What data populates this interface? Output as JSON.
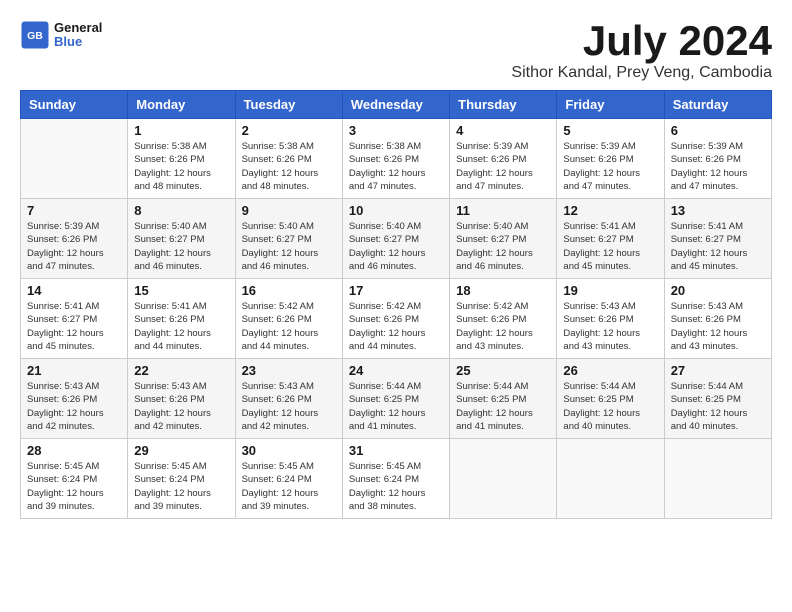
{
  "header": {
    "logo": {
      "general": "General",
      "blue": "Blue"
    },
    "title": "July 2024",
    "location": "Sithor Kandal, Prey Veng, Cambodia"
  },
  "days_of_week": [
    "Sunday",
    "Monday",
    "Tuesday",
    "Wednesday",
    "Thursday",
    "Friday",
    "Saturday"
  ],
  "weeks": [
    [
      {
        "day": "",
        "info": ""
      },
      {
        "day": "1",
        "info": "Sunrise: 5:38 AM\nSunset: 6:26 PM\nDaylight: 12 hours\nand 48 minutes."
      },
      {
        "day": "2",
        "info": "Sunrise: 5:38 AM\nSunset: 6:26 PM\nDaylight: 12 hours\nand 48 minutes."
      },
      {
        "day": "3",
        "info": "Sunrise: 5:38 AM\nSunset: 6:26 PM\nDaylight: 12 hours\nand 47 minutes."
      },
      {
        "day": "4",
        "info": "Sunrise: 5:39 AM\nSunset: 6:26 PM\nDaylight: 12 hours\nand 47 minutes."
      },
      {
        "day": "5",
        "info": "Sunrise: 5:39 AM\nSunset: 6:26 PM\nDaylight: 12 hours\nand 47 minutes."
      },
      {
        "day": "6",
        "info": "Sunrise: 5:39 AM\nSunset: 6:26 PM\nDaylight: 12 hours\nand 47 minutes."
      }
    ],
    [
      {
        "day": "7",
        "info": "Sunrise: 5:39 AM\nSunset: 6:26 PM\nDaylight: 12 hours\nand 47 minutes."
      },
      {
        "day": "8",
        "info": "Sunrise: 5:40 AM\nSunset: 6:27 PM\nDaylight: 12 hours\nand 46 minutes."
      },
      {
        "day": "9",
        "info": "Sunrise: 5:40 AM\nSunset: 6:27 PM\nDaylight: 12 hours\nand 46 minutes."
      },
      {
        "day": "10",
        "info": "Sunrise: 5:40 AM\nSunset: 6:27 PM\nDaylight: 12 hours\nand 46 minutes."
      },
      {
        "day": "11",
        "info": "Sunrise: 5:40 AM\nSunset: 6:27 PM\nDaylight: 12 hours\nand 46 minutes."
      },
      {
        "day": "12",
        "info": "Sunrise: 5:41 AM\nSunset: 6:27 PM\nDaylight: 12 hours\nand 45 minutes."
      },
      {
        "day": "13",
        "info": "Sunrise: 5:41 AM\nSunset: 6:27 PM\nDaylight: 12 hours\nand 45 minutes."
      }
    ],
    [
      {
        "day": "14",
        "info": "Sunrise: 5:41 AM\nSunset: 6:27 PM\nDaylight: 12 hours\nand 45 minutes."
      },
      {
        "day": "15",
        "info": "Sunrise: 5:41 AM\nSunset: 6:26 PM\nDaylight: 12 hours\nand 44 minutes."
      },
      {
        "day": "16",
        "info": "Sunrise: 5:42 AM\nSunset: 6:26 PM\nDaylight: 12 hours\nand 44 minutes."
      },
      {
        "day": "17",
        "info": "Sunrise: 5:42 AM\nSunset: 6:26 PM\nDaylight: 12 hours\nand 44 minutes."
      },
      {
        "day": "18",
        "info": "Sunrise: 5:42 AM\nSunset: 6:26 PM\nDaylight: 12 hours\nand 43 minutes."
      },
      {
        "day": "19",
        "info": "Sunrise: 5:43 AM\nSunset: 6:26 PM\nDaylight: 12 hours\nand 43 minutes."
      },
      {
        "day": "20",
        "info": "Sunrise: 5:43 AM\nSunset: 6:26 PM\nDaylight: 12 hours\nand 43 minutes."
      }
    ],
    [
      {
        "day": "21",
        "info": "Sunrise: 5:43 AM\nSunset: 6:26 PM\nDaylight: 12 hours\nand 42 minutes."
      },
      {
        "day": "22",
        "info": "Sunrise: 5:43 AM\nSunset: 6:26 PM\nDaylight: 12 hours\nand 42 minutes."
      },
      {
        "day": "23",
        "info": "Sunrise: 5:43 AM\nSunset: 6:26 PM\nDaylight: 12 hours\nand 42 minutes."
      },
      {
        "day": "24",
        "info": "Sunrise: 5:44 AM\nSunset: 6:25 PM\nDaylight: 12 hours\nand 41 minutes."
      },
      {
        "day": "25",
        "info": "Sunrise: 5:44 AM\nSunset: 6:25 PM\nDaylight: 12 hours\nand 41 minutes."
      },
      {
        "day": "26",
        "info": "Sunrise: 5:44 AM\nSunset: 6:25 PM\nDaylight: 12 hours\nand 40 minutes."
      },
      {
        "day": "27",
        "info": "Sunrise: 5:44 AM\nSunset: 6:25 PM\nDaylight: 12 hours\nand 40 minutes."
      }
    ],
    [
      {
        "day": "28",
        "info": "Sunrise: 5:45 AM\nSunset: 6:24 PM\nDaylight: 12 hours\nand 39 minutes."
      },
      {
        "day": "29",
        "info": "Sunrise: 5:45 AM\nSunset: 6:24 PM\nDaylight: 12 hours\nand 39 minutes."
      },
      {
        "day": "30",
        "info": "Sunrise: 5:45 AM\nSunset: 6:24 PM\nDaylight: 12 hours\nand 39 minutes."
      },
      {
        "day": "31",
        "info": "Sunrise: 5:45 AM\nSunset: 6:24 PM\nDaylight: 12 hours\nand 38 minutes."
      },
      {
        "day": "",
        "info": ""
      },
      {
        "day": "",
        "info": ""
      },
      {
        "day": "",
        "info": ""
      }
    ]
  ]
}
